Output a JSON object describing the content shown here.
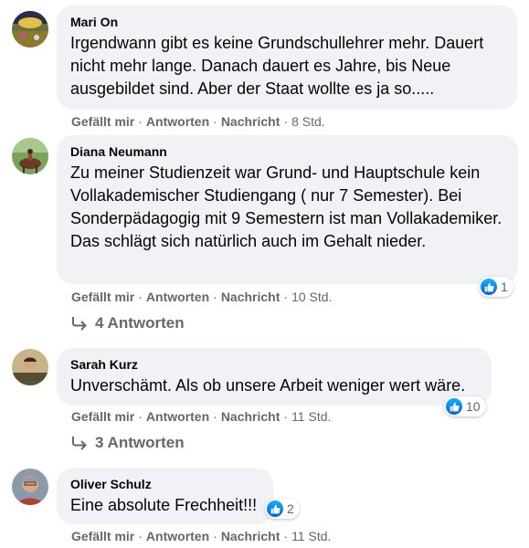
{
  "comments": [
    {
      "author": "Mari On",
      "text": "Irgendwann gibt es keine Grundschullehrer mehr. Dauert nicht mehr lange. Danach dauert es Jahre, bis Neue ausgebildet sind. Aber der Staat wollte es ja so.....",
      "actions": {
        "like": "Gefällt mir",
        "reply": "Antworten",
        "message": "Nachricht",
        "time": "8 Std."
      }
    },
    {
      "author": "Diana Neumann",
      "text": "Zu meiner Studienzeit war Grund- und Hauptschule kein Vollakademischer Studiengang ( nur 7 Semester). Bei Sonderpädagogig mit 9 Semestern ist man Vollakademiker. Das schlägt sich natürlich auch im Gehalt nieder.",
      "reactions": "1",
      "actions": {
        "like": "Gefällt mir",
        "reply": "Antworten",
        "message": "Nachricht",
        "time": "10 Std."
      },
      "replies": "4 Antworten"
    },
    {
      "author": "Sarah Kurz",
      "text": "Unverschämt. Als ob unsere Arbeit weniger wert wäre.",
      "reactions": "10",
      "actions": {
        "like": "Gefällt mir",
        "reply": "Antworten",
        "message": "Nachricht",
        "time": "11 Std."
      },
      "replies": "3 Antworten"
    },
    {
      "author": "Oliver Schulz",
      "text": "Eine absolute Frechheit!!!",
      "reactions": "2",
      "actions": {
        "like": "Gefällt mir",
        "reply": "Antworten",
        "message": "Nachricht",
        "time": "11 Std."
      }
    }
  ],
  "separator": "·",
  "colors": {
    "bubble": "#f0f2f5",
    "meta": "#65676b",
    "like_blue": "#0866ff"
  }
}
